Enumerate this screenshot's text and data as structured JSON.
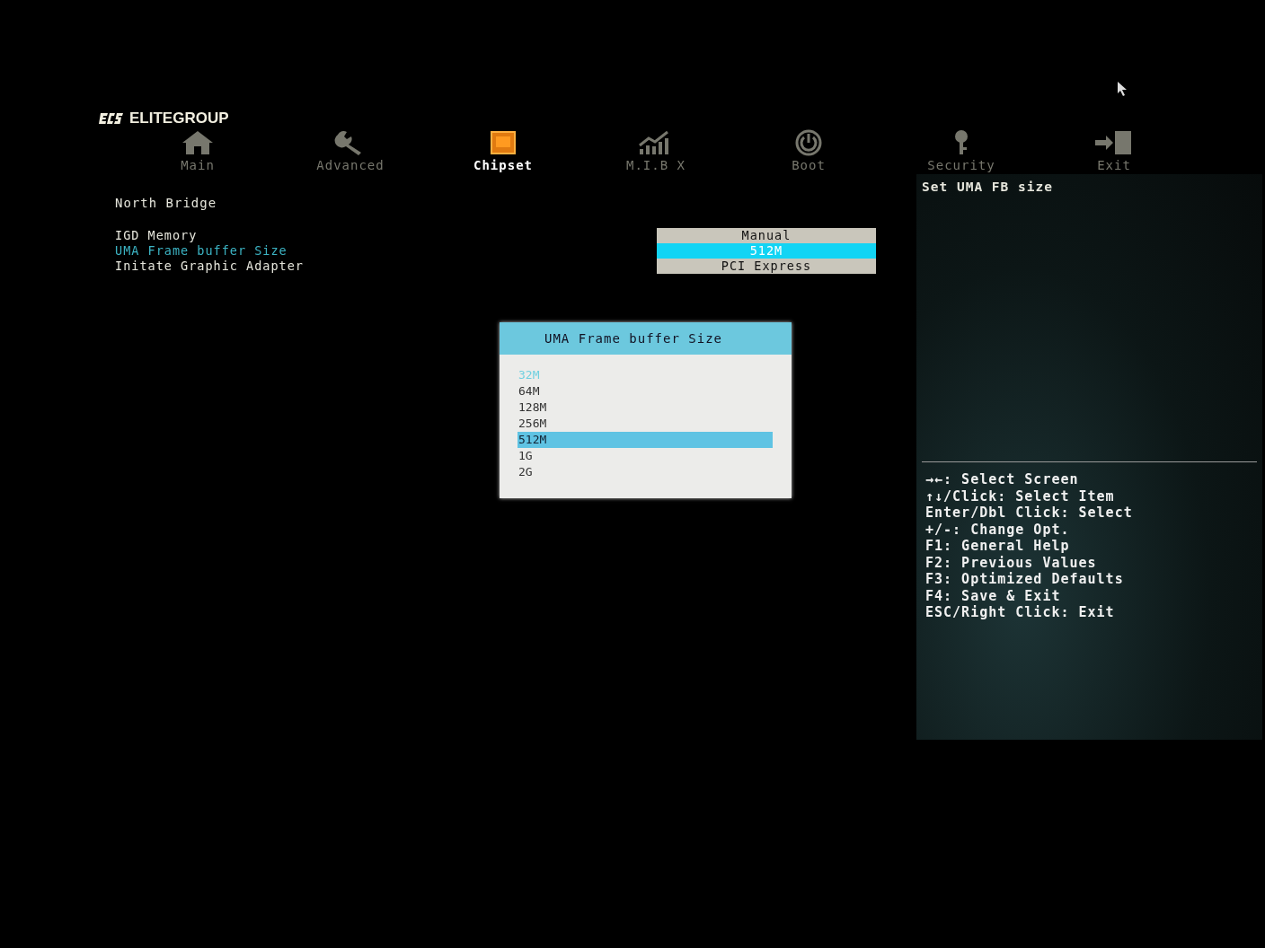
{
  "brand": {
    "name": "ELITEGROUP"
  },
  "tabs": [
    {
      "label": "Main",
      "kind": "house",
      "selected": false
    },
    {
      "label": "Advanced",
      "kind": "wrench",
      "selected": false
    },
    {
      "label": "Chipset",
      "kind": "chip",
      "selected": true
    },
    {
      "label": "M.I.B X",
      "kind": "chart",
      "selected": false
    },
    {
      "label": "Boot",
      "kind": "power",
      "selected": false
    },
    {
      "label": "Security",
      "kind": "key",
      "selected": false
    },
    {
      "label": "Exit",
      "kind": "exit",
      "selected": false
    }
  ],
  "section_title": "North Bridge",
  "settings": [
    {
      "label": "IGD Memory",
      "value": "Manual",
      "selected": false
    },
    {
      "label": "UMA Frame buffer Size",
      "value": "512M",
      "selected": true
    },
    {
      "label": "Initate Graphic Adapter",
      "value": "PCI Express",
      "selected": false
    }
  ],
  "help": {
    "description": "Set UMA FB size",
    "keys": [
      "→←: Select Screen",
      "↑↓/Click: Select Item",
      "Enter/Dbl Click: Select",
      "+/-: Change Opt.",
      "F1: General Help",
      "F2: Previous Values",
      "F3: Optimized Defaults",
      "F4: Save & Exit",
      "ESC/Right Click: Exit"
    ]
  },
  "popup": {
    "title": "UMA Frame buffer Size",
    "options": [
      {
        "label": "32M",
        "selected": false,
        "highlighted": true
      },
      {
        "label": "64M",
        "selected": false,
        "highlighted": false
      },
      {
        "label": "128M",
        "selected": false,
        "highlighted": false
      },
      {
        "label": "256M",
        "selected": false,
        "highlighted": false
      },
      {
        "label": "512M",
        "selected": true,
        "highlighted": false
      },
      {
        "label": "1G",
        "selected": false,
        "highlighted": false
      },
      {
        "label": "2G",
        "selected": false,
        "highlighted": false
      }
    ]
  }
}
